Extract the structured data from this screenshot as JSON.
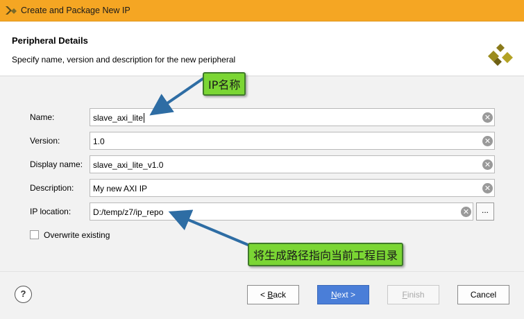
{
  "window": {
    "title": "Create and Package New IP"
  },
  "header": {
    "heading": "Peripheral Details",
    "subtitle": "Specify name, version and description for the new peripheral"
  },
  "form": {
    "name": {
      "label": "Name:",
      "value": "slave_axi_lite"
    },
    "version": {
      "label": "Version:",
      "value": "1.0"
    },
    "display_name": {
      "label": "Display name:",
      "value": "slave_axi_lite_v1.0"
    },
    "description": {
      "label": "Description:",
      "value": "My new AXI IP"
    },
    "ip_location": {
      "label": "IP location:",
      "value": "D:/temp/z7/ip_repo",
      "browse_label": "..."
    },
    "overwrite": {
      "label": "Overwrite existing",
      "checked": false
    }
  },
  "annotations": {
    "ip_name": "IP名称",
    "path_note": "将生成路径指向当前工程目录"
  },
  "footer": {
    "help_label": "?",
    "back_prefix": "< ",
    "back_key": "B",
    "back_rest": "ack",
    "next_key": "N",
    "next_rest": "ext >",
    "finish_key": "F",
    "finish_rest": "inish",
    "cancel_label": "Cancel"
  },
  "colors": {
    "titlebar": "#f5a623",
    "primary_button": "#4a7ed8",
    "annotation_fill": "#7bd634",
    "arrow": "#2e6da4"
  },
  "icons": {
    "app": "vivado-logo-icon",
    "clear": "clear-x-icon",
    "help": "help-icon"
  }
}
